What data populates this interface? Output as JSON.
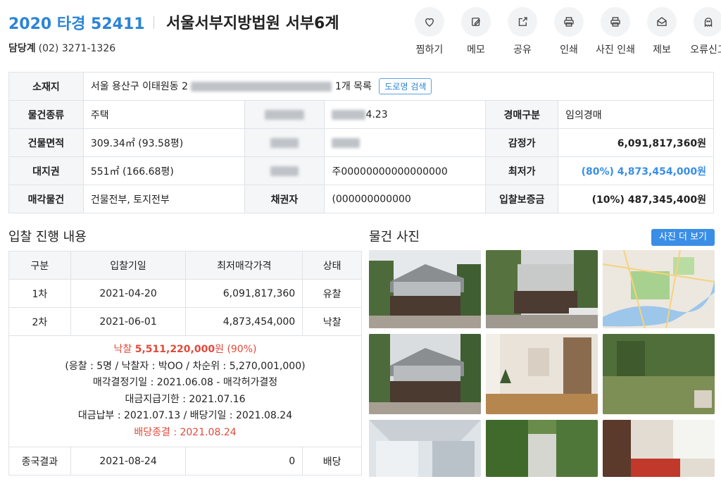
{
  "header": {
    "case_no": "2020 타경 52411",
    "court": "서울서부지방법원 서부6계",
    "contact_label": "담당계",
    "contact_phone": "(02) 3271-1326"
  },
  "actions": [
    {
      "label": "찜하기",
      "icon": "heart-icon"
    },
    {
      "label": "메모",
      "icon": "memo-icon"
    },
    {
      "label": "공유",
      "icon": "share-icon"
    },
    {
      "label": "인쇄",
      "icon": "print-icon"
    },
    {
      "label": "사진 인쇄",
      "icon": "photo-print-icon"
    },
    {
      "label": "제보",
      "icon": "report-icon"
    },
    {
      "label": "오류신고",
      "icon": "error-report-icon"
    }
  ],
  "info": {
    "address_label": "소재지",
    "address_value": "서울 용산구 이태원동 2",
    "address_suffix": "1개 목록",
    "road_search": "도로명 검색",
    "type_label": "물건종류",
    "type_value": "주택",
    "date_tail": "4.23",
    "auction_kind_label": "경매구분",
    "auction_kind_value": "임의경매",
    "building_area_label": "건물면적",
    "building_area_value": "309.34㎡ (93.58평)",
    "appraisal_label": "감정가",
    "appraisal_value": "6,091,817,360원",
    "land_label": "대지권",
    "land_value": "551㎡ (166.68평)",
    "debtor_value": "주00000000000000000",
    "min_price_label": "최저가",
    "min_price_value": "(80%) 4,873,454,000원",
    "sale_item_label": "매각물건",
    "sale_item_value": "건물전부, 토지전부",
    "creditor_label": "채권자",
    "creditor_value": "(000000000000",
    "deposit_label": "입찰보증금",
    "deposit_value": "(10%) 487,345,400원"
  },
  "bids": {
    "title": "입찰 진행 내용",
    "headers": [
      "구분",
      "입찰기일",
      "최저매각가격",
      "상태"
    ],
    "rows": [
      {
        "round": "1차",
        "date": "2021-04-20",
        "price": "6,091,817,360",
        "status": "유찰"
      },
      {
        "round": "2차",
        "date": "2021-06-01",
        "price": "4,873,454,000",
        "status": "낙찰"
      }
    ],
    "summary": {
      "won_label": "낙찰",
      "won_price": "5,511,220,000",
      "won_unit": "원",
      "won_pct": "(90%)",
      "line2": "(응찰 : 5명 / 낙찰자 : 박OO / 차순위 : 5,270,001,000)",
      "line3": "매각결정기일 : 2021.06.08 - 매각허가결정",
      "line4": "대금지급기한 : 2021.07.16",
      "line5": "대금납부 : 2021.07.13 / 배당기일 : 2021.08.24",
      "line6": "배당종결 : 2021.08.24"
    },
    "final": {
      "label": "종국결과",
      "date": "2021-08-24",
      "price": "0",
      "status": "배당"
    }
  },
  "photos": {
    "title": "물건 사진",
    "more": "사진 더 보기"
  }
}
